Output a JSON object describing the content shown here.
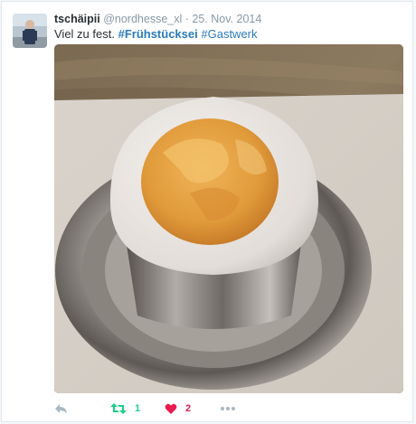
{
  "tweet": {
    "display_name": "tschäipii",
    "handle": "@nordhesse_xl",
    "separator": "·",
    "date": "25. Nov. 2014",
    "text_plain": "Viel zu fest.",
    "hashtag_1": "#Frühstücksei",
    "hashtag_2": "#Gastwerk"
  },
  "actions": {
    "reply_icon": "reply-icon",
    "retweet_icon": "retweet-icon",
    "retweet_count": "1",
    "like_icon": "heart-icon",
    "like_count": "2",
    "more_icon": "more-icon"
  },
  "colors": {
    "retweet_green": "#19cf86",
    "like_red": "#e81c4f",
    "link_blue": "#2b7bb9",
    "muted_gray": "#8899a6"
  }
}
